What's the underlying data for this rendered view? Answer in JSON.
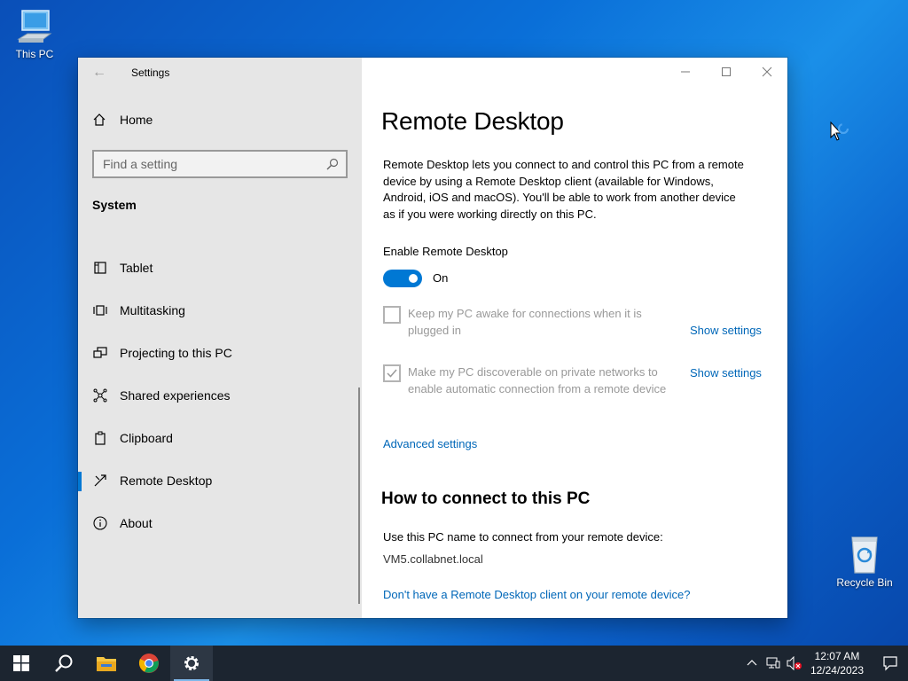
{
  "desktop": {
    "this_pc_label": "This PC",
    "recycle_bin_label": "Recycle Bin"
  },
  "window": {
    "title": "Settings",
    "sidebar": {
      "home_label": "Home",
      "search_placeholder": "Find a setting",
      "section": "System",
      "items": [
        {
          "label": "Tablet",
          "icon": "tablet-icon"
        },
        {
          "label": "Multitasking",
          "icon": "multitasking-icon"
        },
        {
          "label": "Projecting to this PC",
          "icon": "projecting-icon"
        },
        {
          "label": "Shared experiences",
          "icon": "shared-experiences-icon"
        },
        {
          "label": "Clipboard",
          "icon": "clipboard-icon"
        },
        {
          "label": "Remote Desktop",
          "icon": "remote-desktop-icon",
          "active": true
        },
        {
          "label": "About",
          "icon": "info-icon"
        }
      ]
    },
    "content": {
      "title": "Remote Desktop",
      "description": "Remote Desktop lets you connect to and control this PC from a remote device by using a Remote Desktop client (available for Windows, Android, iOS and macOS). You'll be able to work from another device as if you were working directly on this PC.",
      "enable_label": "Enable Remote Desktop",
      "toggle_state": "On",
      "checkbox1_label": "Keep my PC awake for connections when it is plugged in",
      "checkbox2_label": "Make my PC discoverable on private networks to enable automatic connection from a remote device",
      "show_settings_label": "Show settings",
      "advanced_settings_label": "Advanced settings",
      "how_to_title": "How to connect to this PC",
      "connect_label": "Use this PC name to connect from your remote device:",
      "pc_name": "VM5.collabnet.local",
      "no_client_link": "Don't have a Remote Desktop client on your remote device?"
    }
  },
  "taskbar": {
    "time": "12:07 AM",
    "date": "12/24/2023"
  },
  "colors": {
    "accent": "#0078d4",
    "link": "#0067b8",
    "taskbar": "#1c2530"
  }
}
